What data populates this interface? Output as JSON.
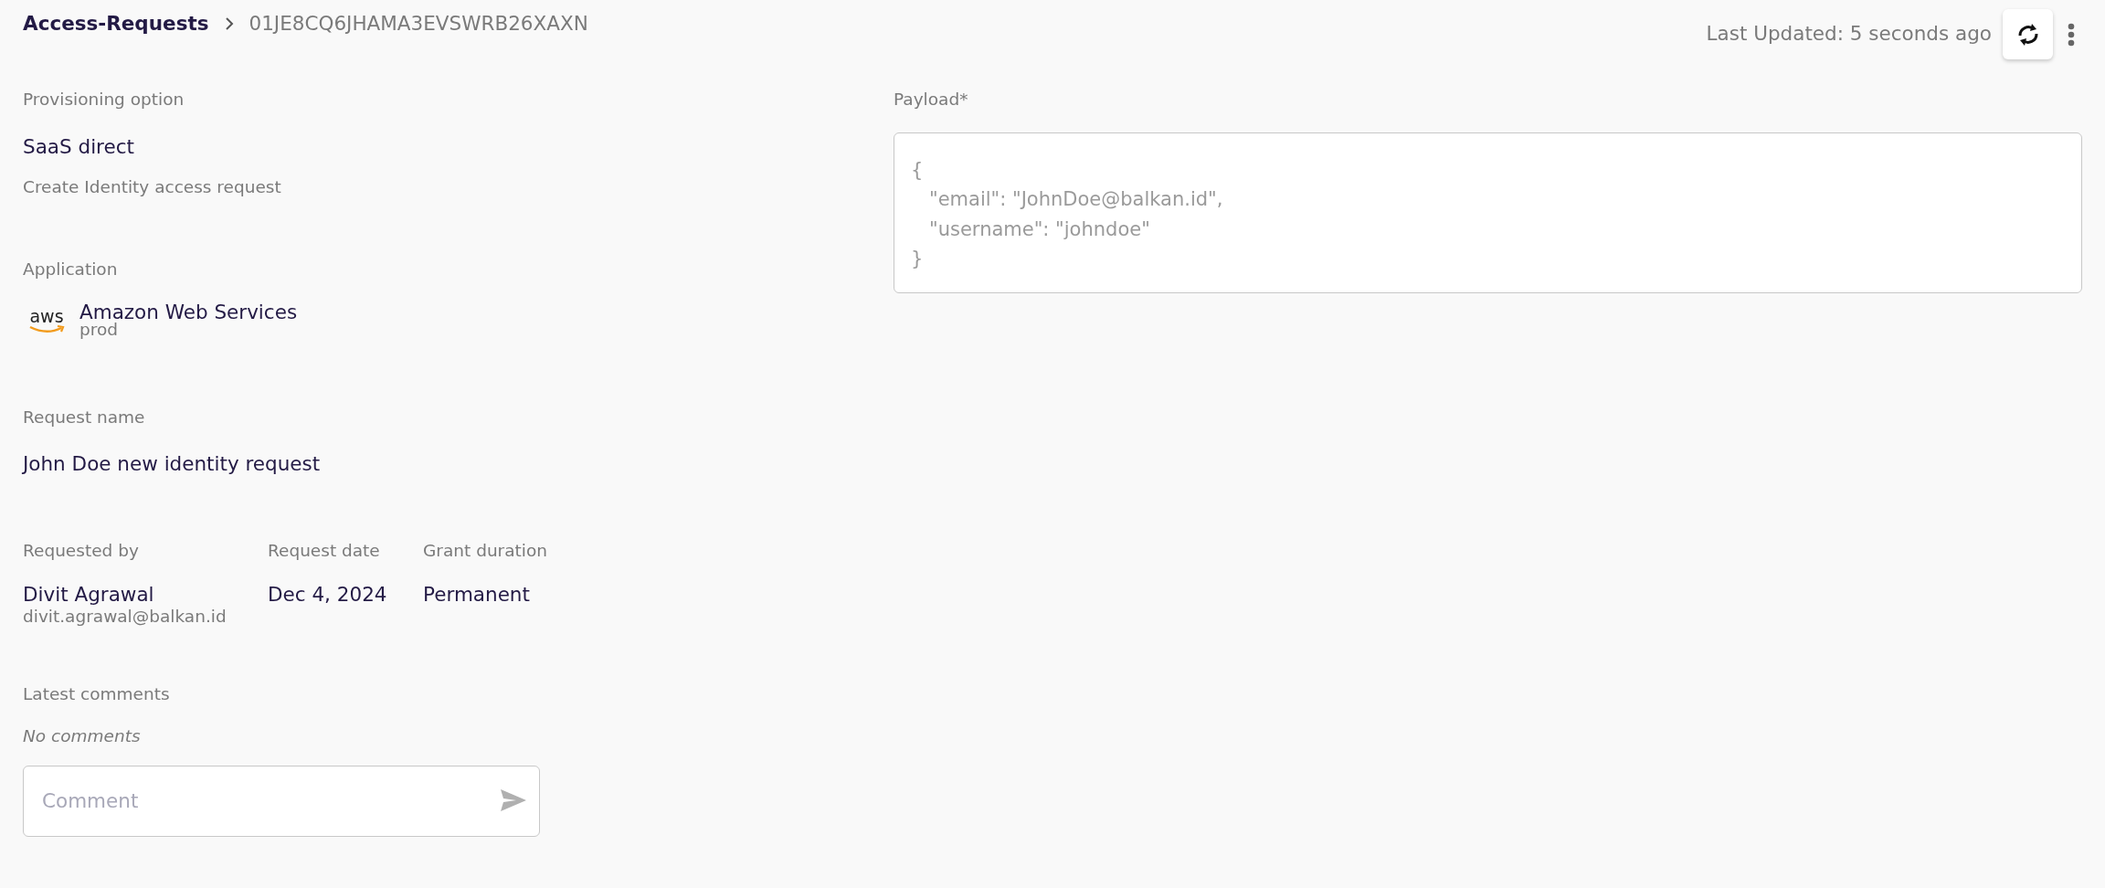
{
  "breadcrumb": {
    "parent": "Access-Requests",
    "current": "01JE8CQ6JHAMA3EVSWRB26XAXN"
  },
  "header": {
    "last_updated": "Last Updated: 5 seconds ago"
  },
  "provisioning": {
    "label": "Provisioning option",
    "value": "SaaS direct",
    "description": "Create Identity access request"
  },
  "application": {
    "label": "Application",
    "logo_text": "aws",
    "name": "Amazon Web Services",
    "environment": "prod"
  },
  "request_name": {
    "label": "Request name",
    "value": "John Doe new identity request"
  },
  "details": [
    {
      "label": "Requested by",
      "value": "Divit Agrawal",
      "sub": "divit.agrawal@balkan.id"
    },
    {
      "label": "Request date",
      "value": "Dec 4, 2024"
    },
    {
      "label": "Grant duration",
      "value": "Permanent"
    }
  ],
  "comments": {
    "label": "Latest comments",
    "empty_text": "No comments",
    "placeholder": "Comment"
  },
  "payload": {
    "label": "Payload*",
    "placeholder": "{\n   \"email\": \"JohnDoe@balkan.id\",\n   \"username\": \"johndoe\"\n}"
  }
}
